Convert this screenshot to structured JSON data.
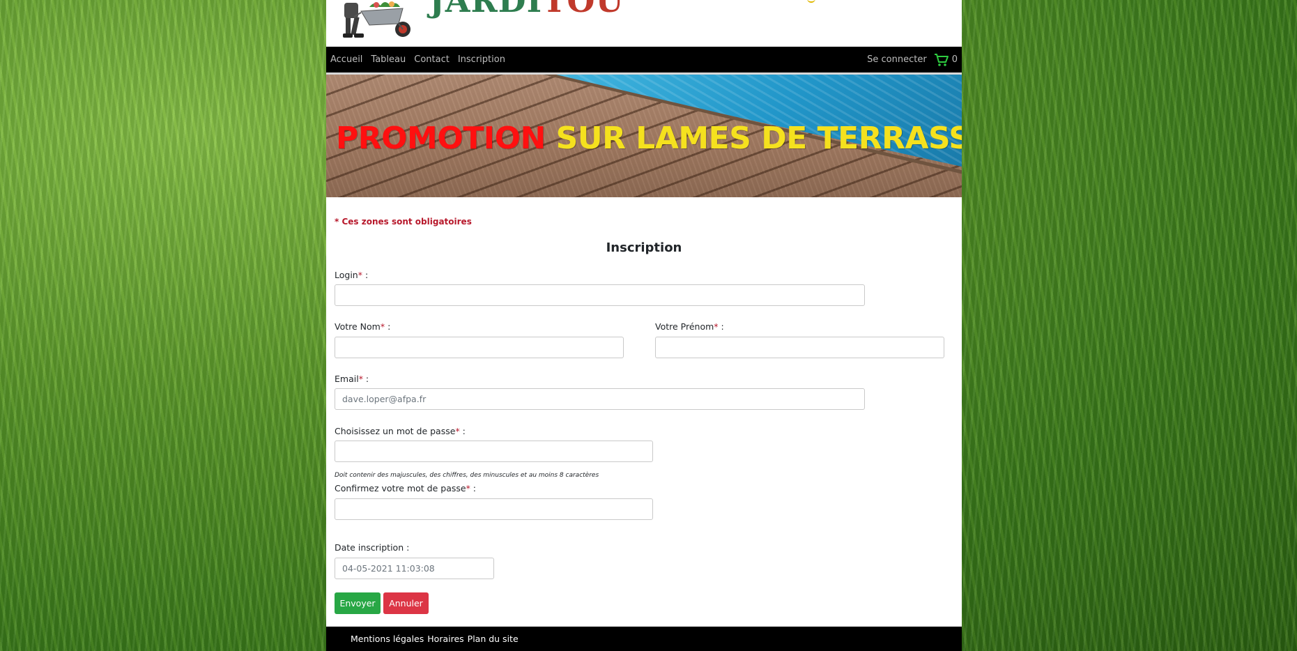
{
  "brand": {
    "name_part1": "JARDI",
    "name_part2": "TOU"
  },
  "nav": {
    "links": [
      {
        "label": "Accueil"
      },
      {
        "label": "Tableau"
      },
      {
        "label": "Contact"
      },
      {
        "label": "Inscription"
      }
    ],
    "login_label": "Se connecter",
    "cart_count": "0",
    "cart_icon": "cart-icon"
  },
  "banner": {
    "title_red": "PROMOTION",
    "title_yellow": "SUR LAMES DE TERRASSE"
  },
  "form": {
    "required_note": "* Ces zones sont obligatoires",
    "title": "Inscription",
    "login_label": "Login",
    "nom_label": "Votre Nom",
    "prenom_label": "Votre Prénom",
    "email_label": "Email",
    "email_placeholder": "dave.loper@afpa.fr",
    "password_label": "Choisissez un mot de passe",
    "password_hint": "Doit contenir des majuscules, des chiffres, des minuscules et au moins 8 caractères",
    "confirm_label": "Confirmez votre mot de passe",
    "date_label": "Date inscription :",
    "date_value": "04-05-2021 11:03:08",
    "required_star": "*",
    "label_suffix": " :",
    "submit_label": "Envoyer",
    "cancel_label": "Annuler"
  },
  "footer": {
    "links": [
      {
        "label": "Mentions légales"
      },
      {
        "label": "Horaires"
      },
      {
        "label": "Plan du site"
      }
    ]
  },
  "colors": {
    "required_red": "#b7182b",
    "submit_green": "#28a745",
    "cancel_red": "#dc3545",
    "banner_red": "#ff1010",
    "banner_yellow": "#f5e11e"
  }
}
